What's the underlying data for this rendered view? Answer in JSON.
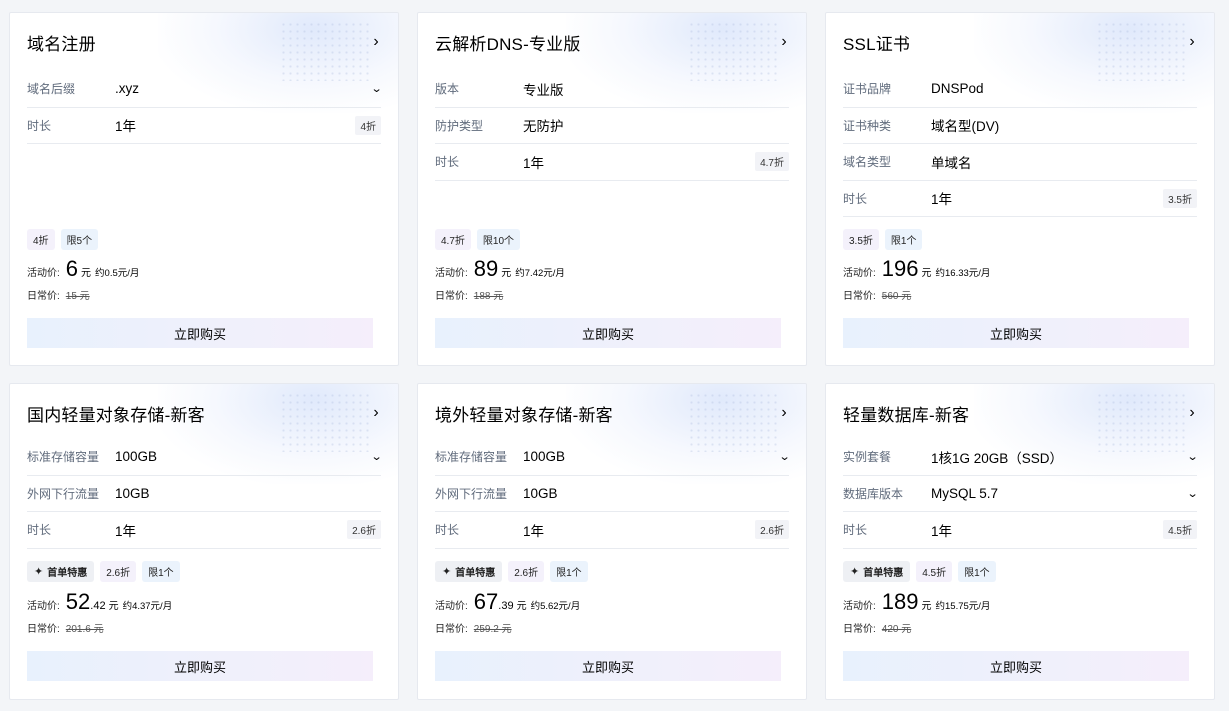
{
  "cards": [
    {
      "title": "域名注册",
      "rows": [
        {
          "label": "域名后缀",
          "value": ".xyz",
          "select": true
        },
        {
          "label": "时长",
          "value": "1年",
          "badge": "4折"
        }
      ],
      "first_order": "",
      "discount": "4折",
      "limit": "限5个",
      "price_label": "活动价:",
      "price_int": "6",
      "price_dec": "",
      "price_unit": "元",
      "per_month": "约0.5元/月",
      "orig_label": "日常价:",
      "orig_value": "15 元",
      "buy": "立即购买"
    },
    {
      "title": "云解析DNS-专业版",
      "rows": [
        {
          "label": "版本",
          "value": "专业版"
        },
        {
          "label": "防护类型",
          "value": "无防护"
        },
        {
          "label": "时长",
          "value": "1年",
          "badge": "4.7折"
        }
      ],
      "first_order": "",
      "discount": "4.7折",
      "limit": "限10个",
      "price_label": "活动价:",
      "price_int": "89",
      "price_dec": "",
      "price_unit": "元",
      "per_month": "约7.42元/月",
      "orig_label": "日常价:",
      "orig_value": "188 元",
      "buy": "立即购买"
    },
    {
      "title": "SSL证书",
      "rows": [
        {
          "label": "证书品牌",
          "value": "DNSPod"
        },
        {
          "label": "证书种类",
          "value": "域名型(DV)"
        },
        {
          "label": "域名类型",
          "value": "单域名"
        },
        {
          "label": "时长",
          "value": "1年",
          "badge": "3.5折"
        }
      ],
      "first_order": "",
      "discount": "3.5折",
      "limit": "限1个",
      "price_label": "活动价:",
      "price_int": "196",
      "price_dec": "",
      "price_unit": "元",
      "per_month": "约16.33元/月",
      "orig_label": "日常价:",
      "orig_value": "560 元",
      "buy": "立即购买"
    },
    {
      "title": "国内轻量对象存储-新客",
      "rows": [
        {
          "label": "标准存储容量",
          "value": "100GB",
          "select": true
        },
        {
          "label": "外网下行流量",
          "value": "10GB"
        },
        {
          "label": "时长",
          "value": "1年",
          "badge": "2.6折"
        }
      ],
      "first_order": "首单特惠",
      "discount": "2.6折",
      "limit": "限1个",
      "price_label": "活动价:",
      "price_int": "52",
      "price_dec": ".42",
      "price_unit": "元",
      "per_month": "约4.37元/月",
      "orig_label": "日常价:",
      "orig_value": "201.6 元",
      "buy": "立即购买"
    },
    {
      "title": "境外轻量对象存储-新客",
      "rows": [
        {
          "label": "标准存储容量",
          "value": "100GB",
          "select": true
        },
        {
          "label": "外网下行流量",
          "value": "10GB"
        },
        {
          "label": "时长",
          "value": "1年",
          "badge": "2.6折"
        }
      ],
      "first_order": "首单特惠",
      "discount": "2.6折",
      "limit": "限1个",
      "price_label": "活动价:",
      "price_int": "67",
      "price_dec": ".39",
      "price_unit": "元",
      "per_month": "约5.62元/月",
      "orig_label": "日常价:",
      "orig_value": "259.2 元",
      "buy": "立即购买"
    },
    {
      "title": "轻量数据库-新客",
      "rows": [
        {
          "label": "实例套餐",
          "value": "1核1G 20GB（SSD）",
          "select": true
        },
        {
          "label": "数据库版本",
          "value": "MySQL 5.7",
          "select": true
        },
        {
          "label": "时长",
          "value": "1年",
          "badge": "4.5折"
        }
      ],
      "first_order": "首单特惠",
      "discount": "4.5折",
      "limit": "限1个",
      "price_label": "活动价:",
      "price_int": "189",
      "price_dec": "",
      "price_unit": "元",
      "per_month": "约15.75元/月",
      "orig_label": "日常价:",
      "orig_value": "420 元",
      "buy": "立即购买"
    }
  ]
}
